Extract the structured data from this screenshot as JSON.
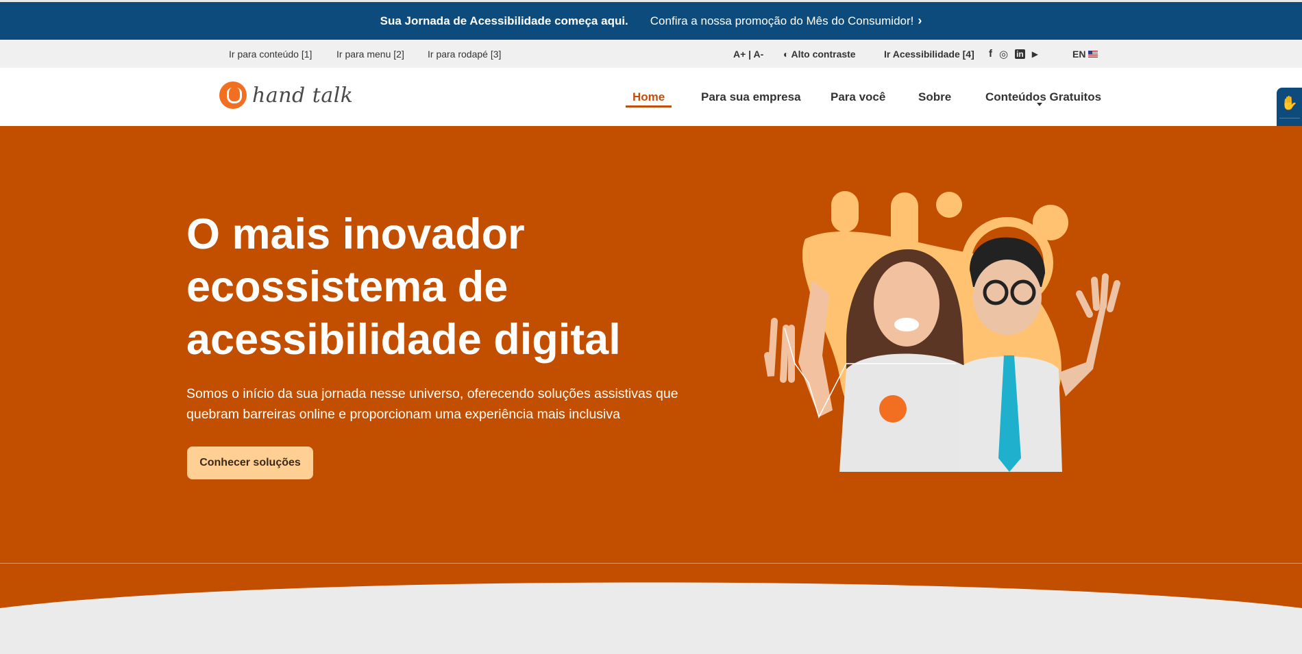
{
  "promo": {
    "strong": "Sua Jornada de Acessibilidade começa aqui.",
    "link": "Confira a nossa promoção do Mês do Consumidor!",
    "chevron": "›"
  },
  "a11y_bar": {
    "skip_content": "Ir para conteúdo [1]",
    "skip_menu": "Ir para menu [2]",
    "skip_footer": "Ir para rodapé [3]",
    "font_size": "A+ | A-",
    "contrast_icon": "◐",
    "contrast": "Alto contraste",
    "accessibility": "Ir Acessibilidade [4]",
    "social": {
      "facebook": "f",
      "instagram": "◎",
      "linkedin": "in",
      "youtube": "▶"
    },
    "language": "EN"
  },
  "header": {
    "logo_text": "hand talk",
    "nav": [
      "Home",
      "Para sua empresa",
      "Para você",
      "Sobre",
      "Conteúdos Gratuitos"
    ]
  },
  "side_widget": {
    "sign_icon": "✋",
    "eye_icon": "◉"
  },
  "hero": {
    "title": "O mais inovador ecossistema de acessibilidade digital",
    "subtitle": "Somos o início da sua jornada nesse universo, oferecendo soluções assistivas que quebram barreiras online e proporcionam uma experiência mais inclusiva",
    "cta": "Conhecer soluções"
  },
  "colors": {
    "promo_bg": "#0d4b7c",
    "hero_bg": "#c24e00",
    "accent": "#c24e0b",
    "cta_bg": "#ffcf93",
    "illustration_yellow": "#ffc271"
  }
}
